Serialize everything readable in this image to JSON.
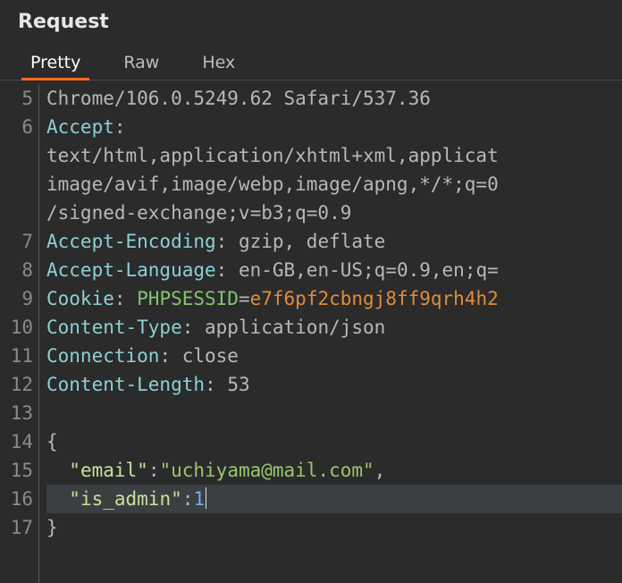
{
  "panel": {
    "title": "Request"
  },
  "tabs": [
    {
      "label": "Pretty",
      "active": true
    },
    {
      "label": "Raw",
      "active": false
    },
    {
      "label": "Hex",
      "active": false
    }
  ],
  "code": {
    "first_visible_line_number": 5,
    "lines": [
      {
        "n": 5,
        "segments": [
          {
            "t": "Chrome/106.0.5249.62 Safari/537.36",
            "c": "plain"
          }
        ]
      },
      {
        "n": 6,
        "segments": [
          {
            "t": "Accept",
            "c": "header"
          },
          {
            "t": ":",
            "c": "punc"
          }
        ]
      },
      {
        "n": null,
        "segments": [
          {
            "t": "text/html,application/xhtml+xml,applicat",
            "c": "plain"
          }
        ]
      },
      {
        "n": null,
        "segments": [
          {
            "t": "image/avif,image/webp,image/apng,*/*;q=0",
            "c": "plain"
          }
        ]
      },
      {
        "n": null,
        "segments": [
          {
            "t": "/signed-exchange;v=b3;q=0.9",
            "c": "plain"
          }
        ]
      },
      {
        "n": 7,
        "segments": [
          {
            "t": "Accept-Encoding",
            "c": "header"
          },
          {
            "t": ": ",
            "c": "punc"
          },
          {
            "t": "gzip, deflate",
            "c": "plain"
          }
        ]
      },
      {
        "n": 8,
        "segments": [
          {
            "t": "Accept-Language",
            "c": "header"
          },
          {
            "t": ": ",
            "c": "punc"
          },
          {
            "t": "en-GB,en-US;q=0.9,en;q=",
            "c": "plain"
          }
        ]
      },
      {
        "n": 9,
        "segments": [
          {
            "t": "Cookie",
            "c": "header"
          },
          {
            "t": ": ",
            "c": "punc"
          },
          {
            "t": "PHPSESSID",
            "c": "cookie-name"
          },
          {
            "t": "=",
            "c": "punc"
          },
          {
            "t": "e7f6pf2cbngj8ff9qrh4h2",
            "c": "cookie-val"
          }
        ]
      },
      {
        "n": 10,
        "segments": [
          {
            "t": "Content-Type",
            "c": "header"
          },
          {
            "t": ": ",
            "c": "punc"
          },
          {
            "t": "application/json",
            "c": "plain"
          }
        ]
      },
      {
        "n": 11,
        "segments": [
          {
            "t": "Connection",
            "c": "header"
          },
          {
            "t": ": ",
            "c": "punc"
          },
          {
            "t": "close",
            "c": "plain"
          }
        ]
      },
      {
        "n": 12,
        "segments": [
          {
            "t": "Content-Length",
            "c": "header"
          },
          {
            "t": ": ",
            "c": "punc"
          },
          {
            "t": "53",
            "c": "plain"
          }
        ]
      },
      {
        "n": 13,
        "segments": [
          {
            "t": "",
            "c": "plain"
          }
        ]
      },
      {
        "n": 14,
        "segments": [
          {
            "t": "{",
            "c": "punc"
          }
        ]
      },
      {
        "n": 15,
        "segments": [
          {
            "t": "  ",
            "c": "plain"
          },
          {
            "t": "\"email\"",
            "c": "key"
          },
          {
            "t": ":",
            "c": "punc"
          },
          {
            "t": "\"uchiyama@mail.com\"",
            "c": "str"
          },
          {
            "t": ",",
            "c": "punc"
          }
        ]
      },
      {
        "n": 16,
        "highlight": true,
        "cursor_at_end": true,
        "segments": [
          {
            "t": "  ",
            "c": "plain"
          },
          {
            "t": "\"is_admin\"",
            "c": "key"
          },
          {
            "t": ":",
            "c": "punc"
          },
          {
            "t": "1",
            "c": "num"
          }
        ]
      },
      {
        "n": 17,
        "segments": [
          {
            "t": "}",
            "c": "punc"
          }
        ]
      }
    ]
  },
  "colors": {
    "accent": "#ff6b1a",
    "header_token": "#8cd1d1",
    "cookie_name": "#7fc66e",
    "cookie_value": "#e28b3b",
    "json_key": "#c8e29a",
    "json_string": "#9bc66c",
    "json_number": "#72aee6",
    "background": "#2b2b2b"
  }
}
